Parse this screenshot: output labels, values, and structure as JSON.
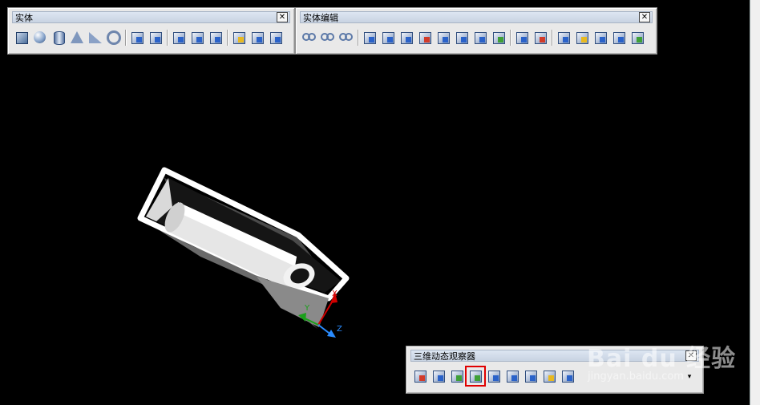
{
  "toolbars": {
    "solid": {
      "title": "实体",
      "close": "✕",
      "icons": [
        {
          "name": "box-icon",
          "shape": "i-box"
        },
        {
          "name": "sphere-icon",
          "shape": "i-sphere"
        },
        {
          "name": "cylinder-icon",
          "shape": "i-cyl"
        },
        {
          "name": "cone-icon",
          "shape": "i-cone"
        },
        {
          "name": "wedge-icon",
          "shape": "i-wedge"
        },
        {
          "name": "torus-icon",
          "shape": "i-torus"
        },
        {
          "sep": true
        },
        {
          "name": "extrude-icon",
          "shape": "i-gen i-blue"
        },
        {
          "name": "revolve-icon",
          "shape": "i-gen i-blue"
        },
        {
          "sep": true
        },
        {
          "name": "slice-icon",
          "shape": "i-gen i-blue"
        },
        {
          "name": "section-icon",
          "shape": "i-gen i-blue"
        },
        {
          "name": "interfere-icon",
          "shape": "i-gen i-blue"
        },
        {
          "sep": true
        },
        {
          "name": "setup-drawing-icon",
          "shape": "i-gen i-yellow"
        },
        {
          "name": "setup-view-icon",
          "shape": "i-gen i-blue"
        },
        {
          "name": "setup-profile-icon",
          "shape": "i-gen i-blue"
        }
      ]
    },
    "solid_edit": {
      "title": "实体编辑",
      "close": "✕",
      "icons": [
        {
          "name": "union-icon",
          "shape": "i-rings"
        },
        {
          "name": "subtract-icon",
          "shape": "i-rings"
        },
        {
          "name": "intersect-icon",
          "shape": "i-rings"
        },
        {
          "sep": true
        },
        {
          "name": "extrude-faces-icon",
          "shape": "i-gen i-blue"
        },
        {
          "name": "move-faces-icon",
          "shape": "i-gen i-blue"
        },
        {
          "name": "offset-faces-icon",
          "shape": "i-gen i-blue"
        },
        {
          "name": "delete-faces-icon",
          "shape": "i-gen i-red"
        },
        {
          "name": "rotate-faces-icon",
          "shape": "i-gen i-blue"
        },
        {
          "name": "taper-faces-icon",
          "shape": "i-gen i-blue"
        },
        {
          "name": "copy-faces-icon",
          "shape": "i-gen i-blue"
        },
        {
          "name": "color-faces-icon",
          "shape": "i-gen i-green"
        },
        {
          "sep": true
        },
        {
          "name": "copy-edges-icon",
          "shape": "i-gen i-blue"
        },
        {
          "name": "color-edges-icon",
          "shape": "i-gen i-red"
        },
        {
          "sep": true
        },
        {
          "name": "imprint-icon",
          "shape": "i-gen i-blue"
        },
        {
          "name": "clean-icon",
          "shape": "i-gen i-yellow"
        },
        {
          "name": "separate-icon",
          "shape": "i-gen i-blue"
        },
        {
          "name": "shell-icon",
          "shape": "i-gen i-blue"
        },
        {
          "name": "check-icon",
          "shape": "i-gen i-green"
        }
      ]
    },
    "orbit": {
      "title": "三维动态观察器",
      "close": "✕",
      "dropdown": "▾",
      "icons": [
        {
          "name": "3d-pan-icon",
          "shape": "i-gen i-red"
        },
        {
          "name": "3d-zoom-icon",
          "shape": "i-gen i-blue"
        },
        {
          "name": "3d-orbit-icon",
          "shape": "i-gen i-green"
        },
        {
          "name": "3d-continuous-orbit-icon",
          "shape": "i-gen i-green",
          "highlight": true
        },
        {
          "name": "3d-swivel-icon",
          "shape": "i-gen i-blue"
        },
        {
          "name": "3d-distance-icon",
          "shape": "i-gen i-blue"
        },
        {
          "name": "3d-clip-icon",
          "shape": "i-gen i-blue"
        },
        {
          "name": "front-clip-icon",
          "shape": "i-gen i-yellow"
        },
        {
          "name": "back-clip-icon",
          "shape": "i-gen i-blue"
        }
      ]
    }
  },
  "axes": {
    "x": "X",
    "y": "Y",
    "z": "Z"
  },
  "watermark": {
    "logo": "Bai du 经验",
    "url": "jingyan.baidu.com"
  },
  "colors": {
    "background": "#000000",
    "toolbar": "#e9e9e9",
    "highlight": "#e00000"
  }
}
